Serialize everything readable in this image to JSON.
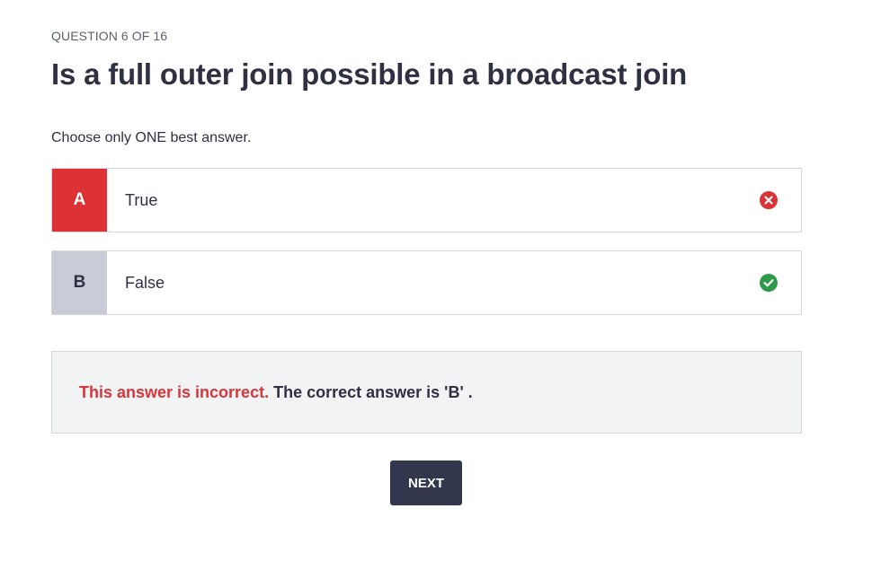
{
  "question": {
    "counter": "QUESTION 6 OF 16",
    "title": "Is a full outer join possible in a broadcast join",
    "instruction": "Choose only ONE best answer."
  },
  "options": [
    {
      "letter": "A",
      "text": "True",
      "state": "incorrect",
      "icon": "x-circle-icon",
      "color": "#dc3235"
    },
    {
      "letter": "B",
      "text": "False",
      "state": "correct",
      "icon": "check-circle-icon",
      "color": "#2e9b4a"
    }
  ],
  "feedback": {
    "incorrect_label": "This answer is incorrect.",
    "correct_answer_text": "The correct answer is 'B' ."
  },
  "actions": {
    "next_label": "NEXT"
  },
  "colors": {
    "wrong": "#dc3235",
    "correct": "#2e9b4a",
    "neutral_letter_bg": "#c9ccd6",
    "button_bg": "#33374d",
    "feedback_bg": "#f2f3f5",
    "text": "#2f3142"
  }
}
